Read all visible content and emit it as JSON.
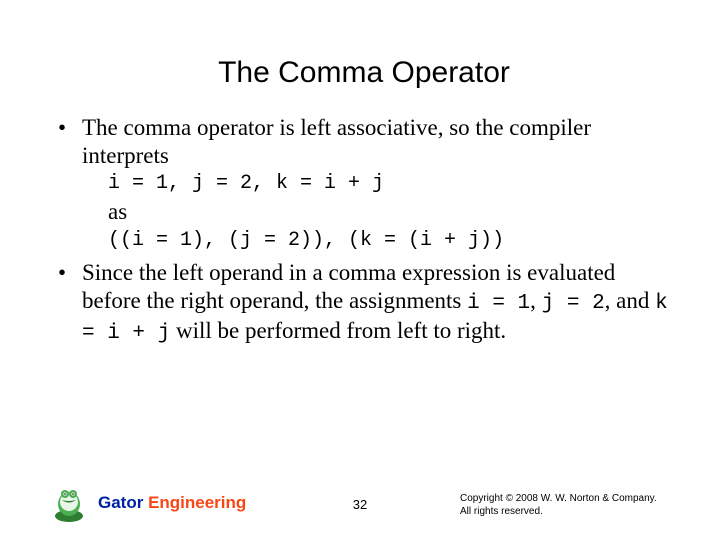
{
  "title": "The Comma Operator",
  "b1_text": "The comma operator is left associative, so the compiler interprets",
  "code1": "i = 1, j = 2, k = i + j",
  "as_word": "as",
  "code2": "((i = 1), (j = 2)), (k = (i + j))",
  "b2_pre": "Since the left operand in a comma expression is evaluated before the right operand, the assignments ",
  "inline1": "i = 1",
  "sep1": ", ",
  "inline2": "j = 2",
  "sep2": ", and ",
  "inline3": "k = i + j",
  "b2_post": " will be performed from left to right.",
  "brand_gator": "Gator ",
  "brand_eng": "Engineering",
  "page_num": "32",
  "copyright_l1": "Copyright © 2008 W. W. Norton & Company.",
  "copyright_l2": "All rights reserved."
}
